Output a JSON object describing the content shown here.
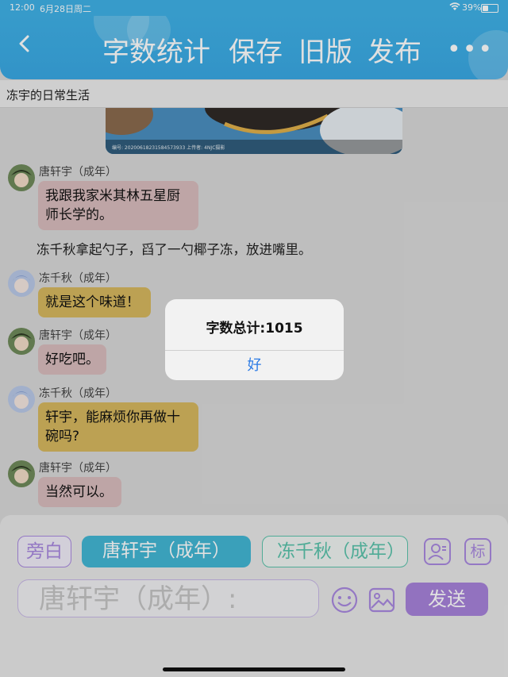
{
  "status_bar": {
    "time": "12:00",
    "date": "6月28日周二",
    "battery": "39%"
  },
  "navbar": {
    "word_count_label": "字数统计",
    "save_label": "保存",
    "old_version_label": "旧版",
    "publish_label": "发布",
    "more_label": "•••"
  },
  "story_title": "冻宇的日常生活",
  "photo_caption": "编号: 20200618231584573933  上传者: 4NJC摄影",
  "messages": [
    {
      "speaker": "唐轩宇（成年）",
      "text": "我跟我家米其林五星厨师长学的。"
    },
    {
      "narration": "冻千秋拿起勺子，舀了一勺椰子冻，放进嘴里。"
    },
    {
      "speaker": "冻千秋（成年）",
      "text": "就是这个味道！"
    },
    {
      "speaker": "唐轩宇（成年）",
      "text": "好吃吧。"
    },
    {
      "speaker": "冻千秋（成年）",
      "text": "轩宇，能麻烦你再做十碗吗?"
    },
    {
      "speaker": "唐轩宇（成年）",
      "text": "当然可以。"
    }
  ],
  "composer": {
    "roles": {
      "aside": "旁白",
      "selected": "唐轩宇（成年）",
      "other": "冻千秋（成年）"
    },
    "input_placeholder": "唐轩宇（成年）:",
    "send_label": "发送",
    "mark_label": "标"
  },
  "dialog": {
    "title": "字数总计:1015",
    "ok_label": "好"
  },
  "colors": {
    "nav_blue": "#3fb1e6",
    "send_purple": "#a782da",
    "selected_role": "#43b7d4",
    "ok_blue": "#2c7be5"
  }
}
